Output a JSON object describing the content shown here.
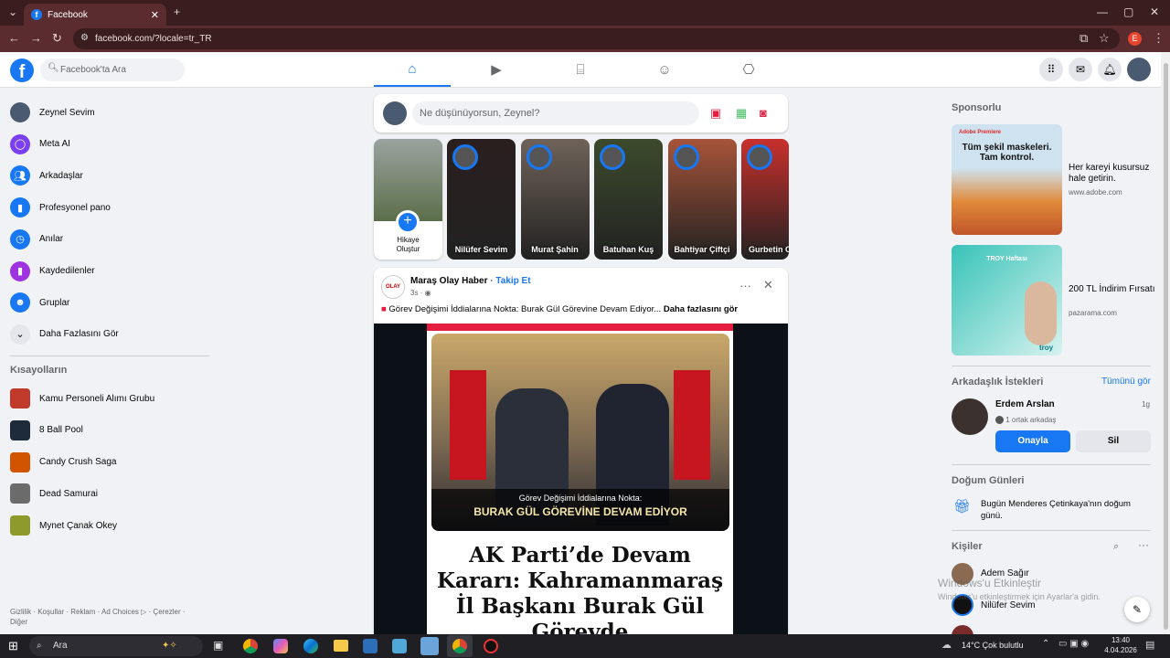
{
  "browser": {
    "tab_title": "Facebook",
    "url": "facebook.com/?locale=tr_TR",
    "profile_letter": "E"
  },
  "header": {
    "search_placeholder": "Facebook'ta Ara"
  },
  "sidebar": {
    "items": [
      {
        "label": "Zeynel Sevim",
        "icon": "avatar-icon",
        "color": "#4a5a70"
      },
      {
        "label": "Meta AI",
        "icon": "meta-ai-icon",
        "color": "#7b3ff2"
      },
      {
        "label": "Arkadaşlar",
        "icon": "friends-icon",
        "color": "#1877f2"
      },
      {
        "label": "Profesyonel pano",
        "icon": "dashboard-icon",
        "color": "#1877f2"
      },
      {
        "label": "Anılar",
        "icon": "memories-icon",
        "color": "#1877f2"
      },
      {
        "label": "Kaydedilenler",
        "icon": "bookmark-icon",
        "color": "#a033e0"
      },
      {
        "label": "Gruplar",
        "icon": "groups-icon",
        "color": "#1877f2"
      },
      {
        "label": "Daha Fazlasını Gör",
        "icon": "chevron-down-icon",
        "color": "#e4e6eb"
      }
    ],
    "shortcuts_title": "Kısayolların",
    "shortcuts": [
      {
        "label": "Kamu Personeli Alımı Grubu",
        "color": "#c0392b"
      },
      {
        "label": "8 Ball Pool",
        "color": "#1d2b3a"
      },
      {
        "label": "Candy Crush Saga",
        "color": "#d35400"
      },
      {
        "label": "Dead Samurai",
        "color": "#6b6b6b"
      },
      {
        "label": "Mynet Çanak Okey",
        "color": "#8e9b2c"
      }
    ],
    "footer": "Gizlilik · Koşullar · Reklam · Ad Choices ▷ · Çerezler · Diğer"
  },
  "composer": {
    "placeholder": "Ne düşünüyorsun, Zeynel?"
  },
  "stories": {
    "create_label_1": "Hikaye",
    "create_label_2": "Oluştur",
    "items": [
      {
        "name": "Nilüfer Sevim",
        "color": "#2a1f1f"
      },
      {
        "name": "Murat Şahin",
        "color": "#6f6359"
      },
      {
        "name": "Batuhan Kuş",
        "color": "#3c4a2c"
      },
      {
        "name": "Bahtiyar Çiftçi",
        "color": "#a7543a"
      },
      {
        "name": "Gurbetin Ci",
        "color": "#c9302c"
      }
    ]
  },
  "post": {
    "author": "Maraş Olay Haber",
    "follow": "Takip Et",
    "time": "3s ·",
    "text": "Görev Değişimi İddialarına Nokta: Burak Gül Görevine Devam Ediyor...",
    "more": "Daha fazlasını gör",
    "image_caption_1": "Görev Değişimi İddialarına Nokta:",
    "image_caption_2": "BURAK GÜL GÖREVİNE DEVAM EDİYOR",
    "headline_1": "AK Parti’de Devam",
    "headline_2": "Kararı: Kahramanmaraş",
    "headline_3": "İl Başkanı Burak Gül",
    "headline_4": "Görevde"
  },
  "right": {
    "sponsored_title": "Sponsorlu",
    "ads": [
      {
        "title": "Her kareyi kusursuz hale getirin.",
        "domain": "www.adobe.com",
        "img_title": "Tüm şekil maskeleri. Tam kontrol.",
        "brand": "Adobe Premiere"
      },
      {
        "title": "200 TL İndirim Fırsatı",
        "domain": "pazarama.com",
        "img_title": "TROY Haftası",
        "brand": "troy"
      }
    ],
    "friend_requests_title": "Arkadaşlık İstekleri",
    "see_all": "Tümünü gör",
    "request": {
      "name": "Erdem Arslan",
      "time": "1g",
      "mutual": "1 ortak arkadaş",
      "confirm": "Onayla",
      "delete": "Sil"
    },
    "birthdays_title": "Doğum Günleri",
    "birthday_text": "Bugün Menderes Çetinkaya'nın doğum günü.",
    "contacts_title": "Kişiler",
    "contacts": [
      "Adem Sağır",
      "Nilüfer Sevim"
    ],
    "watermark_1": "Windows'u Etkinleştir",
    "watermark_2": "Windows'u etkinleştirmek için Ayarlar'a gidin."
  },
  "taskbar": {
    "search": "Ara",
    "weather": "14°C  Çok bulutlu",
    "time": "13:40",
    "date": "4.04.2026"
  }
}
